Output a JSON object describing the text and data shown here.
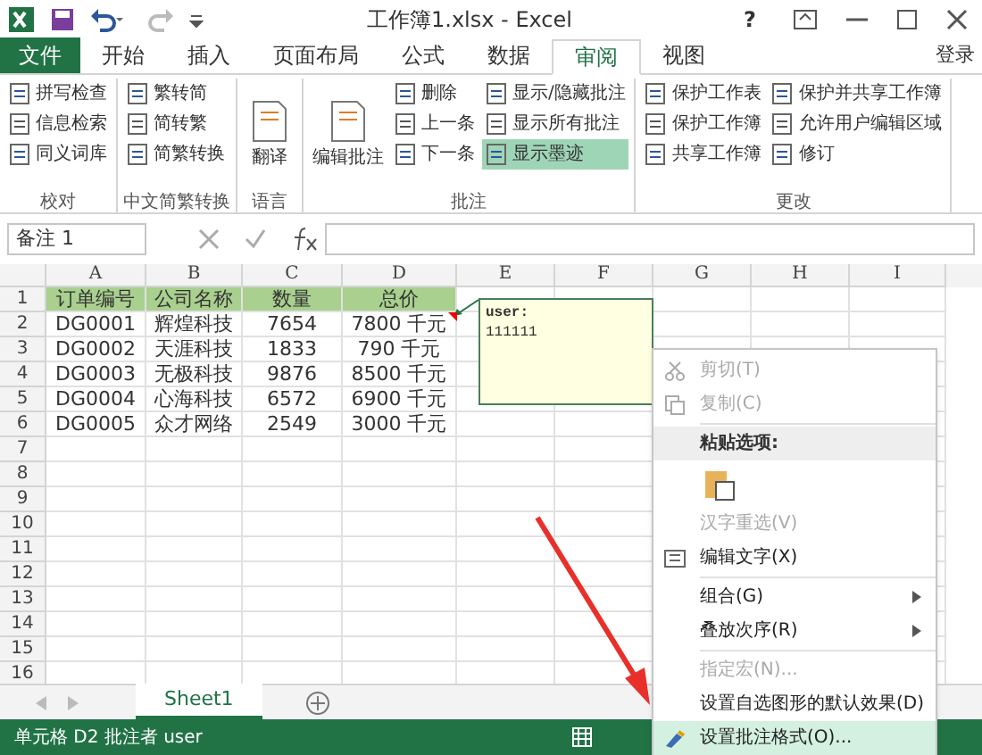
{
  "window": {
    "title": "工作簿1.xlsx - Excel",
    "controls": [
      "?"
    ]
  },
  "file_button": "文件",
  "tabs": [
    {
      "label": "开始",
      "selected": false,
      "kind": "tab"
    },
    {
      "label": "插入",
      "selected": false,
      "kind": "tab"
    },
    {
      "label": "页面布局",
      "selected": false,
      "kind": "tab"
    },
    {
      "label": "公式",
      "selected": false,
      "kind": "tab"
    },
    {
      "label": "数据",
      "selected": false,
      "kind": "tab"
    },
    {
      "label": "审阅",
      "selected": true,
      "kind": "tab"
    },
    {
      "label": "视图",
      "selected": false,
      "kind": "tab"
    }
  ],
  "sign_in": "登录",
  "ribbon_groups": [
    {
      "label": "校对",
      "items": [
        {
          "label": "拼写检查",
          "selected": false
        },
        {
          "label": "信息检索",
          "selected": false
        },
        {
          "label": "同义词库",
          "selected": false
        }
      ]
    },
    {
      "label": "中文简繁转换",
      "items": [
        {
          "label": "繁转简",
          "selected": false
        },
        {
          "label": "简转繁",
          "selected": false
        },
        {
          "label": "简繁转换",
          "selected": false
        }
      ]
    },
    {
      "label": "语言",
      "large": {
        "label": "翻译"
      }
    },
    {
      "label": "批注",
      "large": {
        "label": "编辑批注"
      },
      "items": [
        {
          "label": "删除",
          "selected": false
        },
        {
          "label": "上一条",
          "selected": false
        },
        {
          "label": "下一条",
          "selected": false
        }
      ],
      "items2": [
        {
          "label": "显示/隐藏批注",
          "selected": false
        },
        {
          "label": "显示所有批注",
          "selected": false
        },
        {
          "label": "显示墨迹",
          "selected": true
        }
      ]
    },
    {
      "label": "更改",
      "items": [
        {
          "label": "保护工作表",
          "selected": false
        },
        {
          "label": "保护工作簿",
          "selected": false
        },
        {
          "label": "共享工作簿",
          "selected": false
        }
      ],
      "items2": [
        {
          "label": "保护并共享工作簿",
          "selected": false
        },
        {
          "label": "允许用户编辑区域",
          "selected": false
        },
        {
          "label": "修订",
          "selected": false
        }
      ]
    }
  ],
  "name_box": "备注 1",
  "columns": [
    "A",
    "B",
    "C",
    "D",
    "E",
    "F",
    "G",
    "H",
    "I"
  ],
  "rows": [
    [
      "订单编号",
      "公司名称",
      "数量",
      "总价"
    ],
    [
      "DG0001",
      "辉煌科技",
      "7654",
      "7800  千元"
    ],
    [
      "DG0002",
      "天涯科技",
      "1833",
      "790  千元"
    ],
    [
      "DG0003",
      "无极科技",
      "9876",
      "8500  千元"
    ],
    [
      "DG0004",
      "心海科技",
      "6572",
      "6900  千元"
    ],
    [
      "DG0005",
      "众才网络",
      "2549",
      "3000  千元"
    ]
  ],
  "row_numbers": [
    "1",
    "2",
    "3",
    "4",
    "5",
    "6",
    "7",
    "8",
    "9",
    "10",
    "11",
    "12",
    "13",
    "14",
    "15",
    "16"
  ],
  "comment": {
    "author": "user:",
    "text": "111111"
  },
  "context_menu": [
    {
      "kind": "item",
      "label": "剪切(T)",
      "disabled": true,
      "selected": false
    },
    {
      "kind": "item",
      "label": "复制(C)",
      "disabled": true,
      "selected": false
    },
    {
      "kind": "header",
      "label": "粘贴选项:"
    },
    {
      "kind": "paste"
    },
    {
      "kind": "item",
      "label": "汉字重选(V)",
      "disabled": true,
      "selected": false
    },
    {
      "kind": "item",
      "label": "编辑文字(X)",
      "disabled": false,
      "selected": false
    },
    {
      "kind": "sub",
      "label": "组合(G)",
      "disabled": false,
      "selected": false
    },
    {
      "kind": "sub",
      "label": "叠放次序(R)",
      "disabled": false,
      "selected": false
    },
    {
      "kind": "item",
      "label": "指定宏(N)...",
      "disabled": true,
      "selected": false
    },
    {
      "kind": "item",
      "label": "设置自选图形的默认效果(D)",
      "disabled": false,
      "selected": false
    },
    {
      "kind": "item",
      "label": "设置批注格式(O)...",
      "disabled": false,
      "selected": true
    }
  ],
  "sheet_tabs": [
    {
      "label": "Sheet1",
      "selected": true
    }
  ],
  "status_bar": {
    "text": "单元格 D2 批注者 user"
  }
}
